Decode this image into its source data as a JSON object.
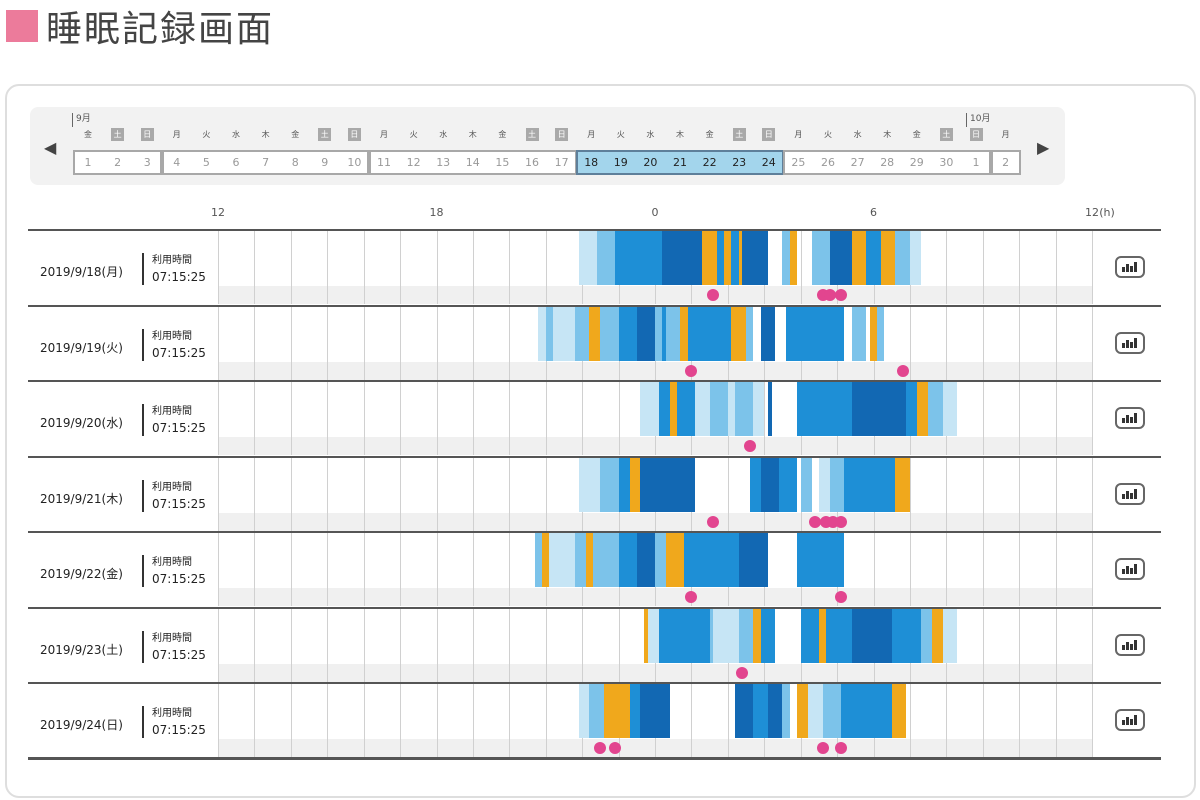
{
  "title": "睡眠記録画面",
  "colors": {
    "accent": "#ec7b9b",
    "deep": "#1268b3",
    "mid": "#1e8fd6",
    "light": "#7cc3ea",
    "pale": "#c6e5f5",
    "awake": "#ffffff",
    "event": "#f0a81c",
    "marker": "#e2458f"
  },
  "calendar": {
    "months": [
      "9月",
      "10月"
    ],
    "weekdays": [
      "金",
      "土",
      "日",
      "月",
      "火",
      "水",
      "木",
      "金",
      "土",
      "日",
      "月",
      "火",
      "水",
      "木",
      "金",
      "土",
      "日",
      "月",
      "火",
      "水",
      "木",
      "金",
      "土",
      "日",
      "月",
      "火",
      "水",
      "木",
      "金",
      "土",
      "日",
      "月"
    ],
    "weekend_flags": [
      0,
      1,
      1,
      0,
      0,
      0,
      0,
      0,
      1,
      1,
      0,
      0,
      0,
      0,
      0,
      1,
      1,
      0,
      0,
      0,
      0,
      0,
      1,
      1,
      0,
      0,
      0,
      0,
      0,
      1,
      1,
      0
    ],
    "days": [
      "1",
      "2",
      "3",
      "4",
      "5",
      "6",
      "7",
      "8",
      "9",
      "10",
      "11",
      "12",
      "13",
      "14",
      "15",
      "16",
      "17",
      "18",
      "19",
      "20",
      "21",
      "22",
      "23",
      "24",
      "25",
      "26",
      "27",
      "28",
      "29",
      "30",
      "1",
      "2"
    ],
    "weeks": [
      [
        0,
        2
      ],
      [
        3,
        9
      ],
      [
        10,
        16
      ],
      [
        17,
        23
      ],
      [
        24,
        30
      ],
      [
        31,
        31
      ]
    ],
    "selected_week": 3,
    "prev_icon": "triangle-left-icon",
    "next_icon": "triangle-right-icon"
  },
  "axis": {
    "ticks": [
      "12",
      "18",
      "0",
      "6",
      "12"
    ],
    "unit": "(h)",
    "tick_hours": [
      0,
      6,
      12,
      18,
      24
    ]
  },
  "usage_label": "利用時間",
  "graph_icon": "graph-icon",
  "rows": [
    {
      "date": "2019/9/18(月)",
      "usage": "07:15:25",
      "segments": [
        [
          9.9,
          10.1,
          "pale"
        ],
        [
          10.1,
          10.4,
          "pale"
        ],
        [
          10.4,
          10.9,
          "light"
        ],
        [
          10.9,
          11.5,
          "mid"
        ],
        [
          11.5,
          12.2,
          "mid"
        ],
        [
          12.2,
          13.3,
          "deep"
        ],
        [
          13.3,
          13.7,
          "event"
        ],
        [
          13.7,
          13.9,
          "mid"
        ],
        [
          13.9,
          14.1,
          "event"
        ],
        [
          14.1,
          14.3,
          "mid"
        ],
        [
          14.3,
          14.4,
          "event"
        ],
        [
          14.4,
          15.1,
          "deep"
        ],
        [
          15.5,
          15.7,
          "light"
        ],
        [
          15.7,
          15.9,
          "event"
        ],
        [
          16.3,
          16.8,
          "light"
        ],
        [
          16.8,
          17.4,
          "deep"
        ],
        [
          17.4,
          17.8,
          "event"
        ],
        [
          17.8,
          18.2,
          "mid"
        ],
        [
          18.2,
          18.6,
          "event"
        ],
        [
          18.6,
          19.0,
          "light"
        ],
        [
          19.0,
          19.3,
          "pale"
        ]
      ],
      "dots": [
        13.6,
        16.6,
        16.8,
        17.1
      ]
    },
    {
      "date": "2019/9/19(火)",
      "usage": "07:15:25",
      "segments": [
        [
          8.8,
          9.0,
          "pale"
        ],
        [
          9.0,
          9.2,
          "light"
        ],
        [
          9.2,
          9.8,
          "pale"
        ],
        [
          9.8,
          10.2,
          "light"
        ],
        [
          10.2,
          10.5,
          "event"
        ],
        [
          10.5,
          11.0,
          "light"
        ],
        [
          11.0,
          11.5,
          "mid"
        ],
        [
          11.5,
          12.0,
          "deep"
        ],
        [
          12.0,
          12.2,
          "light"
        ],
        [
          12.2,
          12.3,
          "mid"
        ],
        [
          12.3,
          12.7,
          "light"
        ],
        [
          12.7,
          12.9,
          "event"
        ],
        [
          12.9,
          14.1,
          "mid"
        ],
        [
          14.1,
          14.5,
          "event"
        ],
        [
          14.5,
          14.7,
          "light"
        ],
        [
          14.9,
          15.3,
          "deep"
        ],
        [
          15.6,
          17.2,
          "mid"
        ],
        [
          17.4,
          17.8,
          "light"
        ],
        [
          17.9,
          18.1,
          "event"
        ],
        [
          18.1,
          18.3,
          "light"
        ]
      ],
      "dots": [
        13.0,
        18.8
      ]
    },
    {
      "date": "2019/9/20(水)",
      "usage": "07:15:25",
      "segments": [
        [
          11.6,
          12.1,
          "pale"
        ],
        [
          12.1,
          12.4,
          "mid"
        ],
        [
          12.4,
          12.6,
          "event"
        ],
        [
          12.6,
          13.1,
          "mid"
        ],
        [
          13.1,
          13.5,
          "pale"
        ],
        [
          13.5,
          14.0,
          "light"
        ],
        [
          14.0,
          14.2,
          "pale"
        ],
        [
          14.2,
          14.7,
          "light"
        ],
        [
          14.7,
          15.0,
          "pale"
        ],
        [
          15.1,
          15.2,
          "deep"
        ],
        [
          15.9,
          17.4,
          "mid"
        ],
        [
          17.4,
          18.1,
          "deep"
        ],
        [
          18.1,
          18.9,
          "deep"
        ],
        [
          18.9,
          19.2,
          "mid"
        ],
        [
          19.2,
          19.5,
          "event"
        ],
        [
          19.5,
          19.9,
          "light"
        ],
        [
          19.9,
          20.3,
          "pale"
        ]
      ],
      "dots": [
        14.6
      ]
    },
    {
      "date": "2019/9/21(木)",
      "usage": "07:15:25",
      "segments": [
        [
          9.9,
          10.1,
          "pale"
        ],
        [
          10.1,
          10.5,
          "pale"
        ],
        [
          10.5,
          11.0,
          "light"
        ],
        [
          11.0,
          11.3,
          "mid"
        ],
        [
          11.3,
          11.6,
          "event"
        ],
        [
          11.6,
          12.4,
          "deep"
        ],
        [
          12.4,
          13.1,
          "deep"
        ],
        [
          14.6,
          14.9,
          "mid"
        ],
        [
          14.9,
          15.4,
          "deep"
        ],
        [
          15.4,
          15.9,
          "mid"
        ],
        [
          16.0,
          16.3,
          "light"
        ],
        [
          16.5,
          16.8,
          "pale"
        ],
        [
          16.8,
          17.2,
          "light"
        ],
        [
          17.2,
          18.6,
          "mid"
        ],
        [
          18.6,
          19.0,
          "event"
        ]
      ],
      "dots": [
        13.6,
        16.4,
        16.7,
        16.9,
        17.1
      ]
    },
    {
      "date": "2019/9/22(金)",
      "usage": "07:15:25",
      "segments": [
        [
          8.7,
          8.9,
          "light"
        ],
        [
          8.9,
          9.1,
          "event"
        ],
        [
          9.1,
          9.8,
          "pale"
        ],
        [
          9.8,
          10.1,
          "light"
        ],
        [
          10.1,
          10.3,
          "event"
        ],
        [
          10.3,
          11.0,
          "light"
        ],
        [
          11.0,
          11.5,
          "mid"
        ],
        [
          11.5,
          12.0,
          "deep"
        ],
        [
          12.0,
          12.3,
          "light"
        ],
        [
          12.3,
          12.8,
          "event"
        ],
        [
          12.8,
          14.3,
          "mid"
        ],
        [
          14.3,
          15.1,
          "deep"
        ],
        [
          15.1,
          15.9,
          "awake"
        ],
        [
          15.9,
          17.2,
          "mid"
        ]
      ],
      "dots": [
        13.0,
        17.1
      ]
    },
    {
      "date": "2019/9/23(土)",
      "usage": "07:15:25",
      "segments": [
        [
          11.7,
          11.8,
          "event"
        ],
        [
          11.8,
          12.1,
          "pale"
        ],
        [
          12.1,
          13.5,
          "mid"
        ],
        [
          13.5,
          13.6,
          "light"
        ],
        [
          13.6,
          14.3,
          "pale"
        ],
        [
          14.3,
          14.7,
          "light"
        ],
        [
          14.7,
          14.9,
          "event"
        ],
        [
          14.9,
          15.3,
          "mid"
        ],
        [
          15.3,
          16.0,
          "awake"
        ],
        [
          16.0,
          16.5,
          "mid"
        ],
        [
          16.5,
          16.7,
          "event"
        ],
        [
          16.7,
          17.4,
          "mid"
        ],
        [
          17.4,
          18.5,
          "deep"
        ],
        [
          18.5,
          19.3,
          "mid"
        ],
        [
          19.3,
          19.6,
          "light"
        ],
        [
          19.6,
          19.9,
          "event"
        ],
        [
          19.9,
          20.3,
          "pale"
        ]
      ],
      "dots": [
        14.4
      ]
    },
    {
      "date": "2019/9/24(日)",
      "usage": "07:15:25",
      "segments": [
        [
          9.9,
          10.2,
          "pale"
        ],
        [
          10.2,
          10.6,
          "light"
        ],
        [
          10.6,
          11.3,
          "event"
        ],
        [
          11.3,
          11.6,
          "mid"
        ],
        [
          11.6,
          12.4,
          "deep"
        ],
        [
          14.2,
          14.7,
          "deep"
        ],
        [
          14.7,
          15.1,
          "mid"
        ],
        [
          15.1,
          15.5,
          "deep"
        ],
        [
          15.5,
          15.7,
          "light"
        ],
        [
          15.9,
          16.2,
          "event"
        ],
        [
          16.2,
          16.6,
          "pale"
        ],
        [
          16.6,
          17.1,
          "light"
        ],
        [
          17.1,
          18.5,
          "mid"
        ],
        [
          18.5,
          18.9,
          "event"
        ]
      ],
      "dots": [
        10.5,
        10.9,
        16.6,
        17.1
      ]
    }
  ]
}
